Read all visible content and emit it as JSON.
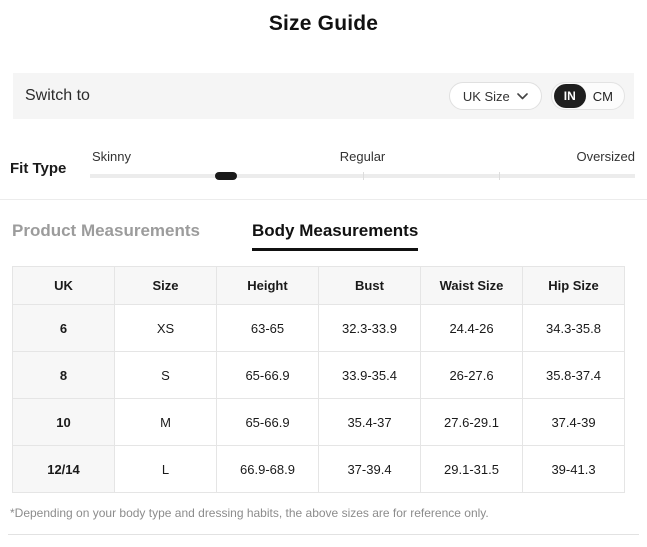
{
  "header": {
    "title": "Size Guide"
  },
  "switch_bar": {
    "label": "Switch to",
    "size_system_dropdown": {
      "selected": "UK Size",
      "icon": "chevron-down-icon"
    },
    "unit_toggle": {
      "selected": "IN",
      "options": [
        "IN",
        "CM"
      ]
    }
  },
  "fit_type": {
    "label": "Fit Type",
    "options": [
      "Skinny",
      "Regular",
      "Oversized"
    ],
    "handle_position_percent": 25
  },
  "tabs": {
    "product": {
      "label": "Product Measurements",
      "active": false
    },
    "body": {
      "label": "Body Measurements",
      "active": true
    }
  },
  "size_table": {
    "columns": [
      "UK",
      "Size",
      "Height",
      "Bust",
      "Waist Size",
      "Hip Size"
    ],
    "rows": [
      [
        "6",
        "XS",
        "63-65",
        "32.3-33.9",
        "24.4-26",
        "34.3-35.8"
      ],
      [
        "8",
        "S",
        "65-66.9",
        "33.9-35.4",
        "26-27.6",
        "35.8-37.4"
      ],
      [
        "10",
        "M",
        "65-66.9",
        "35.4-37",
        "27.6-29.1",
        "37.4-39"
      ],
      [
        "12/14",
        "L",
        "66.9-68.9",
        "37-39.4",
        "29.1-31.5",
        "39-41.3"
      ]
    ]
  },
  "footnote": "*Depending on your body type and dressing habits, the above sizes are for reference only.",
  "colors": {
    "accent": "#1f1f1f",
    "bar_bg": "#f5f5f5",
    "table_header_bg": "#f7f7f7",
    "border": "#e5e5e5",
    "muted_text": "#9c9c9c"
  }
}
